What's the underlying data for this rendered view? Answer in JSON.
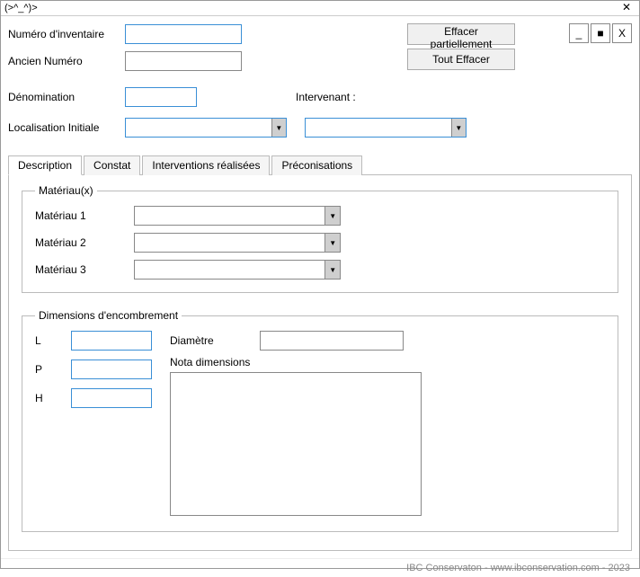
{
  "window": {
    "title": "(>^_^)>"
  },
  "labels": {
    "numero_inventaire": "Numéro d'inventaire",
    "ancien_numero": "Ancien Numéro",
    "denomination": "Dénomination",
    "intervenant": "Intervenant :",
    "localisation_initiale": "Localisation Initiale"
  },
  "buttons": {
    "effacer_partiellement": "Effacer partiellement",
    "tout_effacer": "Tout Effacer",
    "minimize": "_",
    "maximize": "■",
    "close": "X",
    "titlebar_close": "✕"
  },
  "tabs": {
    "description": "Description",
    "constat": "Constat",
    "interventions": "Interventions réalisées",
    "preconisations": "Préconisations"
  },
  "materiaux": {
    "legend": "Matériau(x)",
    "mat1": "Matériau 1",
    "mat2": "Matériau 2",
    "mat3": "Matériau 3"
  },
  "dimensions": {
    "legend": "Dimensions d'encombrement",
    "l": "L",
    "p": "P",
    "h": "H",
    "diametre": "Diamètre",
    "nota": "Nota dimensions"
  },
  "values": {
    "numero_inventaire": "",
    "ancien_numero": "",
    "denomination": "",
    "localisation_initiale": "",
    "intervenant": "",
    "mat1": "",
    "mat2": "",
    "mat3": "",
    "l": "",
    "p": "",
    "h": "",
    "diametre": "",
    "nota": ""
  },
  "footer": "IBC Conservaton - www.ibconservation.com - 2023"
}
